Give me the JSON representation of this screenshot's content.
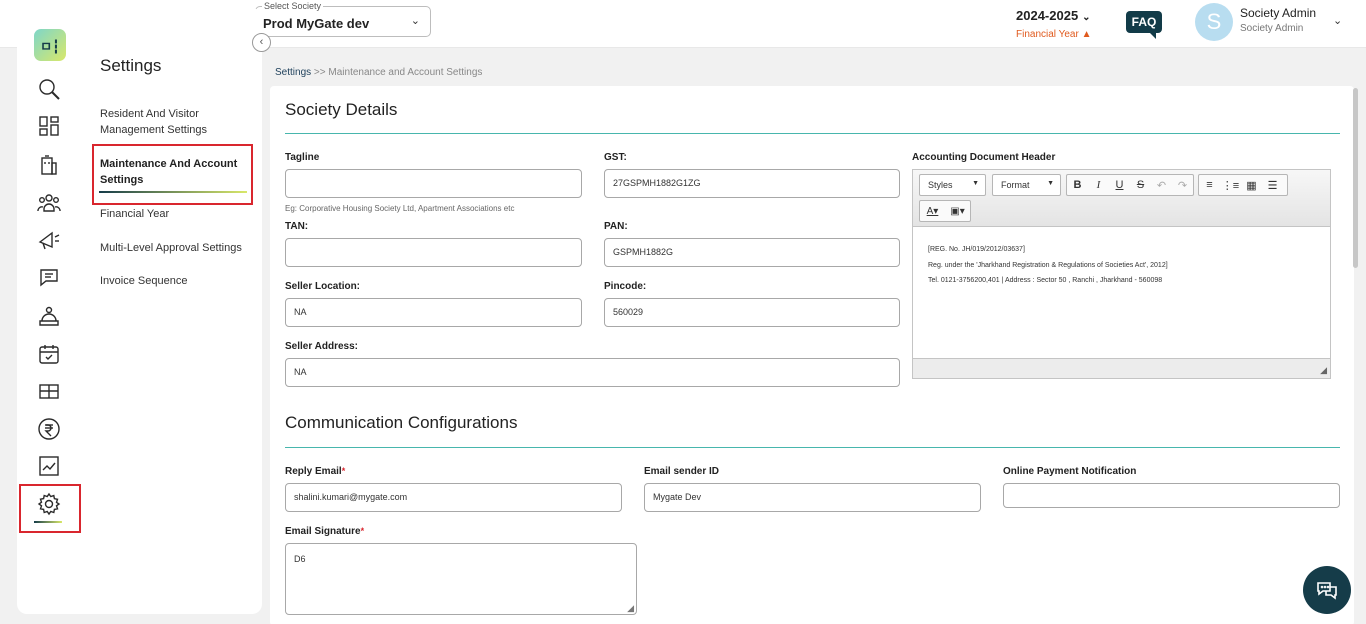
{
  "header": {
    "society_label": "Select Society",
    "society_value": "Prod MyGate dev",
    "financial_year": "2024-2025",
    "financial_year_label": "Financial Year",
    "faq_label": "FAQ",
    "avatar_letter": "S",
    "user_name": "Society Admin",
    "user_role": "Society Admin"
  },
  "sidebar": {
    "logo_text": "ㅁ┇",
    "icons": [
      "search-icon",
      "dashboard-icon",
      "building-icon",
      "residents-icon",
      "announcement-icon",
      "chat-icon",
      "helpdesk-icon",
      "calendar-icon",
      "amenities-icon",
      "rupee-icon",
      "reports-icon",
      "settings-icon"
    ]
  },
  "settings_menu": {
    "title": "Settings",
    "items": [
      {
        "label": "Resident And Visitor Management Settings",
        "active": false
      },
      {
        "label": "Maintenance And Account Settings",
        "active": true
      },
      {
        "label": "Financial Year",
        "active": false
      },
      {
        "label": "Multi-Level Approval Settings",
        "active": false
      },
      {
        "label": "Invoice Sequence",
        "active": false
      }
    ]
  },
  "breadcrumb": {
    "root": "Settings",
    "separator": ">>",
    "current": "Maintenance and Account Settings"
  },
  "society_details": {
    "title": "Society Details",
    "tagline_label": "Tagline",
    "tagline_value": "",
    "tagline_hint": "Eg: Corporative Housing Society Ltd, Apartment Associations etc",
    "gst_label": "GST:",
    "gst_value": "27GSPMH1882G1ZG",
    "tan_label": "TAN:",
    "tan_value": "",
    "pan_label": "PAN:",
    "pan_value": "GSPMH1882G",
    "seller_location_label": "Seller Location:",
    "seller_location_value": "NA",
    "pincode_label": "Pincode:",
    "pincode_value": "560029",
    "seller_address_label": "Seller Address:",
    "seller_address_value": "NA"
  },
  "editor": {
    "label": "Accounting Document Header",
    "styles_label": "Styles",
    "format_label": "Format",
    "lines": [
      "[REG. No. JH/019/2012/03637]",
      "Reg. under the 'Jharkhand Registration & Regulations of Societies Act', 2012]",
      "Tel. 0121-3756200,401 | Address : Sector 50 , Ranchi , Jharkhand - 560098"
    ]
  },
  "communication": {
    "title": "Communication Configurations",
    "reply_email_label": "Reply Email",
    "reply_email_value": "shalini.kumari@mygate.com",
    "sender_id_label": "Email sender ID",
    "sender_id_value": "Mygate Dev",
    "online_payment_label": "Online Payment Notification",
    "online_payment_value": "",
    "signature_label": "Email Signature",
    "signature_value": "D6",
    "required_mark": "*"
  },
  "colors": {
    "accent_dark": "#153c49",
    "teal_line": "#48b6ad",
    "highlight_red": "#d9262e",
    "fy_orange": "#e05a1e"
  }
}
